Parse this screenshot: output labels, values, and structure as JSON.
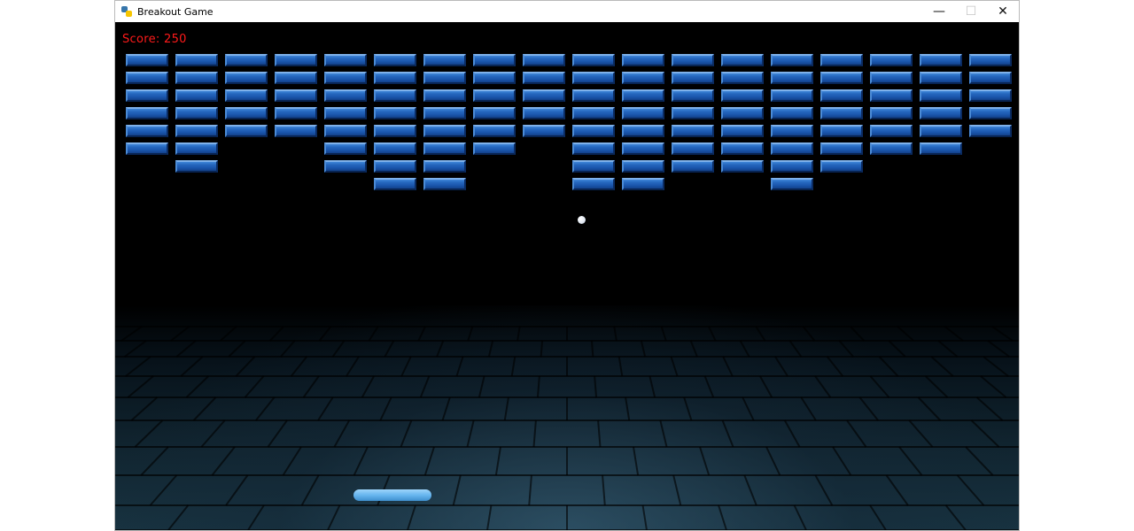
{
  "window": {
    "title": "Breakout Game",
    "controls": {
      "minimize": "—",
      "maximize": "☐",
      "close": "✕"
    }
  },
  "game": {
    "score_text": "Score: 250",
    "score_color": "#ff1a1a",
    "brick_color": "#1a56ad",
    "paddle_color": "#67b6ef",
    "ball_color": "#ffffff",
    "brick_columns": 18,
    "brick_rows": 8,
    "brick_grid": [
      [
        1,
        1,
        1,
        1,
        1,
        1,
        1,
        1,
        1,
        1,
        1,
        1,
        1,
        1,
        1,
        1,
        1,
        1
      ],
      [
        1,
        1,
        1,
        1,
        1,
        1,
        1,
        1,
        1,
        1,
        1,
        1,
        1,
        1,
        1,
        1,
        1,
        1
      ],
      [
        1,
        1,
        1,
        1,
        1,
        1,
        1,
        1,
        1,
        1,
        1,
        1,
        1,
        1,
        1,
        1,
        1,
        1
      ],
      [
        1,
        1,
        1,
        1,
        1,
        1,
        1,
        1,
        1,
        1,
        1,
        1,
        1,
        1,
        1,
        1,
        1,
        1
      ],
      [
        1,
        1,
        1,
        1,
        1,
        1,
        1,
        1,
        1,
        1,
        1,
        1,
        1,
        1,
        1,
        1,
        1,
        1
      ],
      [
        1,
        1,
        0,
        0,
        1,
        1,
        1,
        1,
        0,
        1,
        1,
        1,
        1,
        1,
        1,
        1,
        1,
        0
      ],
      [
        0,
        1,
        0,
        0,
        1,
        1,
        1,
        0,
        0,
        1,
        1,
        1,
        1,
        1,
        1,
        0,
        0,
        0
      ],
      [
        0,
        0,
        0,
        0,
        0,
        1,
        1,
        0,
        0,
        1,
        1,
        0,
        0,
        1,
        0,
        0,
        0,
        0
      ]
    ]
  }
}
